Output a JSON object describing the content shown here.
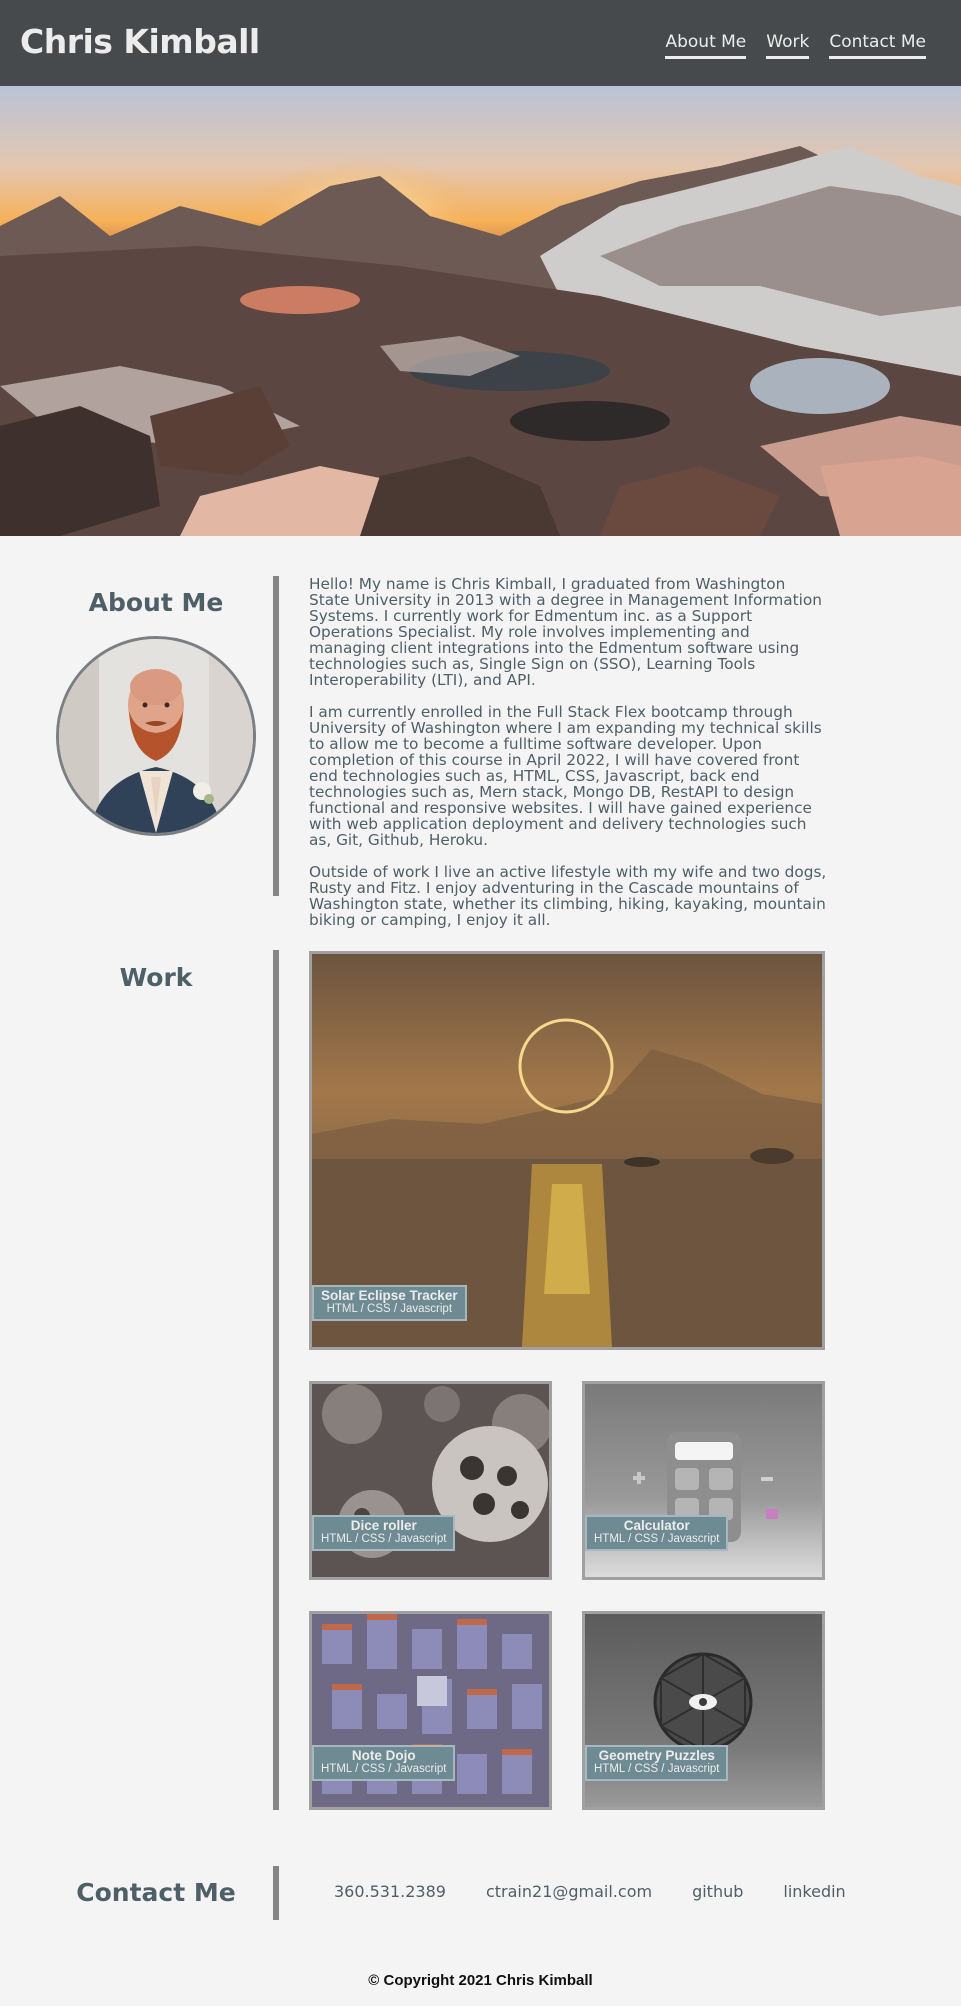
{
  "header": {
    "title": "Chris Kimball",
    "nav": [
      "About Me",
      "Work",
      "Contact Me"
    ]
  },
  "about": {
    "heading": "About Me",
    "paragraphs": [
      "Hello! My name is Chris Kimball, I graduated from Washington State University in 2013 with a degree in Management Information Systems. I currently work for Edmentum inc. as a Support Operations Specialist. My role involves implementing and managing client integrations into the Edmentum software using technologies such as, Single Sign on (SSO), Learning Tools Interoperability (LTI), and API.",
      "I am currently enrolled in the Full Stack Flex bootcamp through University of Washington where I am expanding my technical skills to allow me to become a fulltime software developer. Upon completion of this course in April 2022, I will have covered front end technologies such as, HTML, CSS, Javascript, back end technologies such as, Mern stack, Mongo DB, RestAPI to design functional and responsive websites. I will have gained experience with web application deployment and delivery technologies such as, Git, Github, Heroku.",
      "Outside of work I live an active lifestyle with my wife and two dogs, Rusty and Fitz. I enjoy adventuring in the Cascade mountains of Washington state, whether its climbing, hiking, kayaking, mountain biking or camping, I enjoy it all."
    ]
  },
  "work": {
    "heading": "Work",
    "projects": [
      {
        "title": "Solar Eclipse Tracker",
        "tech": "HTML / CSS / Javascript"
      },
      {
        "title": "Dice roller",
        "tech": "HTML / CSS / Javascript"
      },
      {
        "title": "Calculator",
        "tech": "HTML / CSS / Javascript"
      },
      {
        "title": "Note Dojo",
        "tech": "HTML / CSS / Javascript"
      },
      {
        "title": "Geometry Puzzles",
        "tech": "HTML / CSS / Javascript"
      }
    ]
  },
  "contact": {
    "heading": "Contact Me",
    "links": [
      "360.531.2389",
      "ctrain21@gmail.com",
      "github",
      "linkedin"
    ]
  },
  "footer": {
    "copyright": "© Copyright 2021 Chris Kimball"
  },
  "colors": {
    "header_bg": "#474a4c",
    "page_bg": "#f4f4f4",
    "text": "#4f5f68",
    "caption_bg": "#6e8a92",
    "divider": "#858585"
  }
}
